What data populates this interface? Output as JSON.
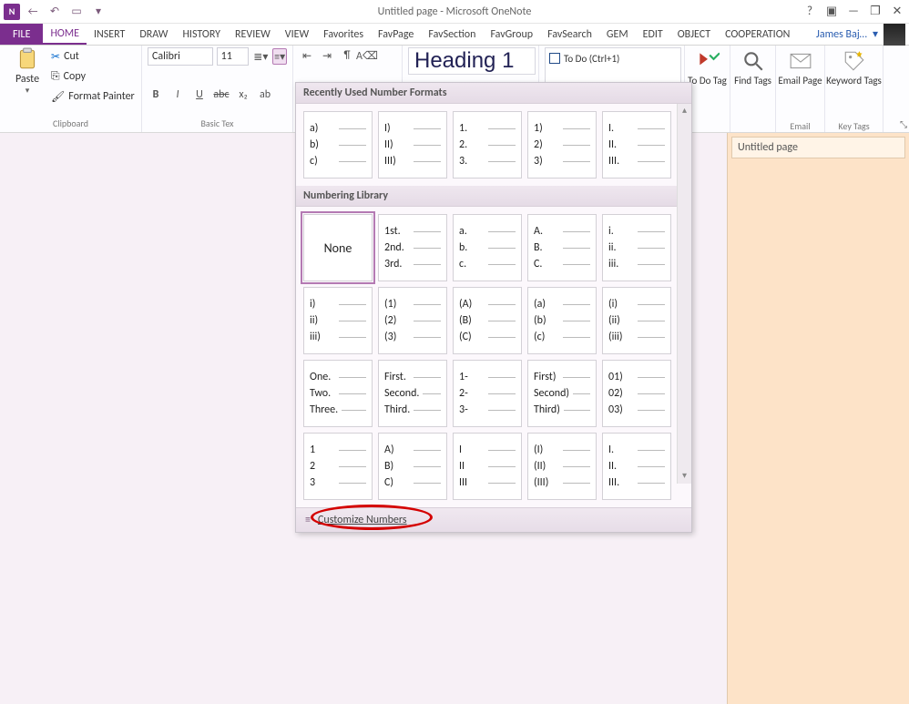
{
  "window": {
    "title": "Untitled page - Microsoft OneNote"
  },
  "qat": {
    "back": "←",
    "undo": "↶",
    "touch": "▭",
    "more": "▾"
  },
  "wincontrols": {
    "help": "?",
    "full": "▣",
    "min": "—",
    "restore": "❐",
    "close": "✕"
  },
  "tabs": [
    "FILE",
    "HOME",
    "INSERT",
    "DRAW",
    "HISTORY",
    "REVIEW",
    "VIEW",
    "Favorites",
    "FavPage",
    "FavSection",
    "FavGroup",
    "FavSearch",
    "GEM",
    "EDIT",
    "OBJECT",
    "COOPERATION"
  ],
  "user": {
    "name": "James Baj…",
    "dd": "▾"
  },
  "ribbon": {
    "paste": "Paste",
    "cut": "Cut",
    "copy": "Copy",
    "formatpainter": "Format Painter",
    "clipboard_label": "Clipboard",
    "font_name": "Calibri",
    "font_size": "11",
    "basictext_label": "Basic Tex",
    "style": "Heading 1",
    "tag_todo": "To Do (Ctrl+1)",
    "todo_btn": "To Do Tag",
    "find_btn": "Find Tags",
    "email_btn": "Email Page",
    "keyword_btn": "Keyword Tags",
    "email_label": "Email",
    "keytags_label": "Key Tags"
  },
  "sidepage": {
    "title": "Untitled page"
  },
  "numdrop": {
    "recent_head": "Recently Used Number Formats",
    "recent": [
      [
        "a)",
        "b)",
        "c)"
      ],
      [
        "I)",
        "II)",
        "III)"
      ],
      [
        "1.",
        "2.",
        "3."
      ],
      [
        "1)",
        "2)",
        "3)"
      ],
      [
        "I.",
        "II.",
        "III."
      ]
    ],
    "library_head": "Numbering Library",
    "none_label": "None",
    "library": [
      [
        "1st.",
        "2nd.",
        "3rd."
      ],
      [
        "a.",
        "b.",
        "c."
      ],
      [
        "A.",
        "B.",
        "C."
      ],
      [
        "i.",
        "ii.",
        "iii."
      ],
      [
        "i)",
        "ii)",
        "iii)"
      ],
      [
        "(1)",
        "(2)",
        "(3)"
      ],
      [
        "(A)",
        "(B)",
        "(C)"
      ],
      [
        "(a)",
        "(b)",
        "(c)"
      ],
      [
        "(i)",
        "(ii)",
        "(iii)"
      ],
      [
        "One.",
        "Two.",
        "Three."
      ],
      [
        "First.",
        "Second.",
        "Third."
      ],
      [
        "1-",
        "2-",
        "3-"
      ],
      [
        "First)",
        "Second)",
        "Third)"
      ],
      [
        "01)",
        "02)",
        "03)"
      ],
      [
        "1",
        "2",
        "3"
      ],
      [
        "A)",
        "B)",
        "C)"
      ],
      [
        "I",
        "II",
        "III"
      ],
      [
        "(I)",
        "(II)",
        "(III)"
      ],
      [
        "I.",
        "II.",
        "III."
      ]
    ],
    "customize": "Customize Numbers"
  }
}
